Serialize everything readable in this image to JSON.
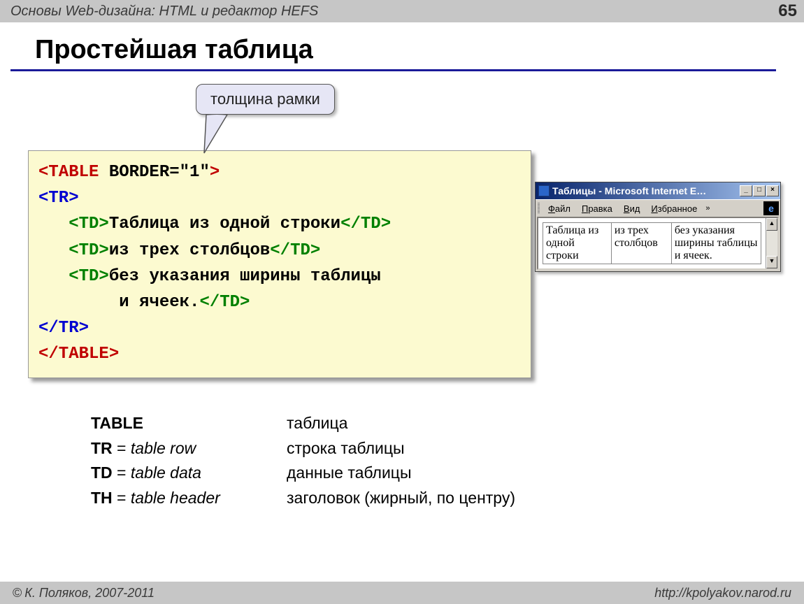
{
  "header": {
    "course": "Основы Web-дизайна: HTML и редактор HEFS",
    "page": "65"
  },
  "title": "Простейшая таблица",
  "callout": "толщина рамки",
  "code": {
    "l1a": "<TABLE",
    "l1b": " BORDER=\"1\"",
    "l1c": ">",
    "l2": "<TR>",
    "l3a": "   <TD>",
    "l3b": "Таблица из одной строки",
    "l3c": "</TD>",
    "l4a": "   <TD>",
    "l4b": "из трех столбцов",
    "l4c": "</TD>",
    "l5a": "   <TD>",
    "l5b": "без указания ширины таблицы",
    "l6a": "        и ячеек.",
    "l6b": "</TD>",
    "l7": "</TR>",
    "l8": "</TABLE>"
  },
  "iewin": {
    "title": "Таблицы - Microsoft Internet E…",
    "menu": {
      "file": "Файл",
      "edit": "Правка",
      "view": "Вид",
      "fav": "Избранное"
    },
    "cells": {
      "c1": "Таблица из одной строки",
      "c2": "из трех столбцов",
      "c3": "без указания ширины таблицы и ячеек."
    }
  },
  "defs": [
    {
      "term": "TABLE",
      "eng": "",
      "ru": "таблица"
    },
    {
      "term": "TR",
      "eng": "table row",
      "ru": "строка таблицы"
    },
    {
      "term": "TD",
      "eng": "table data",
      "ru": "данные таблицы"
    },
    {
      "term": "TH",
      "eng": "table header",
      "ru": "заголовок (жирный, по центру)"
    }
  ],
  "footer": {
    "author": "К. Поляков,  2007-2011",
    "url": "http://kpolyakov.narod.ru"
  }
}
